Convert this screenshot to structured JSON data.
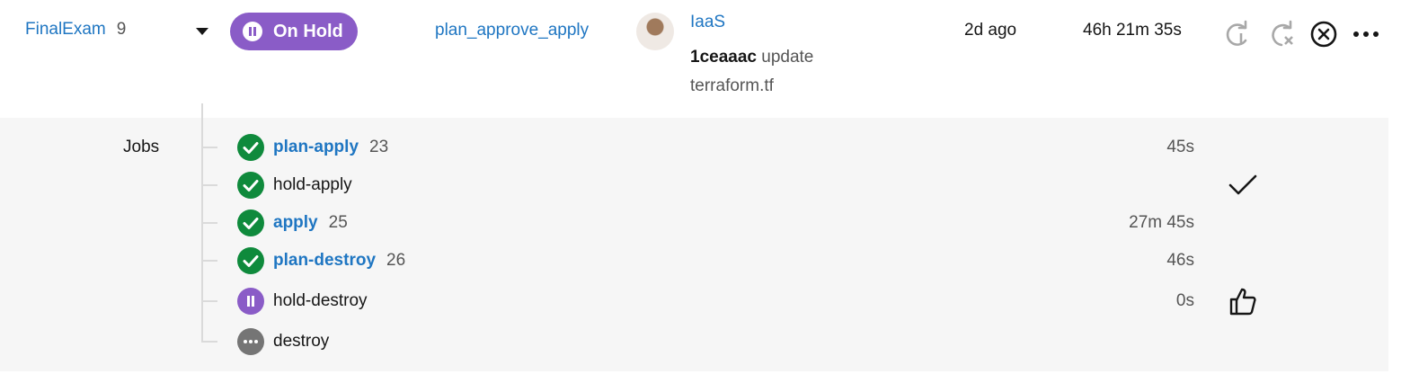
{
  "header": {
    "project_name": "FinalExam",
    "pipeline_number": "9",
    "status_label": "On Hold",
    "workflow_name": "plan_approve_apply",
    "user_name": "IaaS",
    "commit_hash": "1ceaaac",
    "commit_message": "update terraform.tf",
    "time_ago": "2d ago",
    "duration": "46h 21m 35s"
  },
  "jobs_label": "Jobs",
  "jobs": [
    {
      "name": "plan-apply",
      "number": "23",
      "status": "success",
      "duration": "45s"
    },
    {
      "name": "hold-apply",
      "number": "",
      "status": "success",
      "duration": ""
    },
    {
      "name": "apply",
      "number": "25",
      "status": "success",
      "duration": "27m 45s"
    },
    {
      "name": "plan-destroy",
      "number": "26",
      "status": "success",
      "duration": "46s"
    },
    {
      "name": "hold-destroy",
      "number": "",
      "status": "on-hold",
      "duration": "0s"
    },
    {
      "name": "destroy",
      "number": "",
      "status": "not-run",
      "duration": ""
    }
  ],
  "icons": {
    "status": "pause-icon",
    "rerun": "rerun-icon",
    "rerun_failed": "rerun-from-failed-icon",
    "cancel": "cancel-icon",
    "more": "more-options-icon",
    "approved": "checkmark-icon",
    "approve": "thumbs-up-icon"
  },
  "colors": {
    "link": "#1f76c2",
    "on_hold": "#8a5cc7",
    "success": "#0f8a3c",
    "not_run": "#757575",
    "panel_bg": "#f6f6f6"
  }
}
